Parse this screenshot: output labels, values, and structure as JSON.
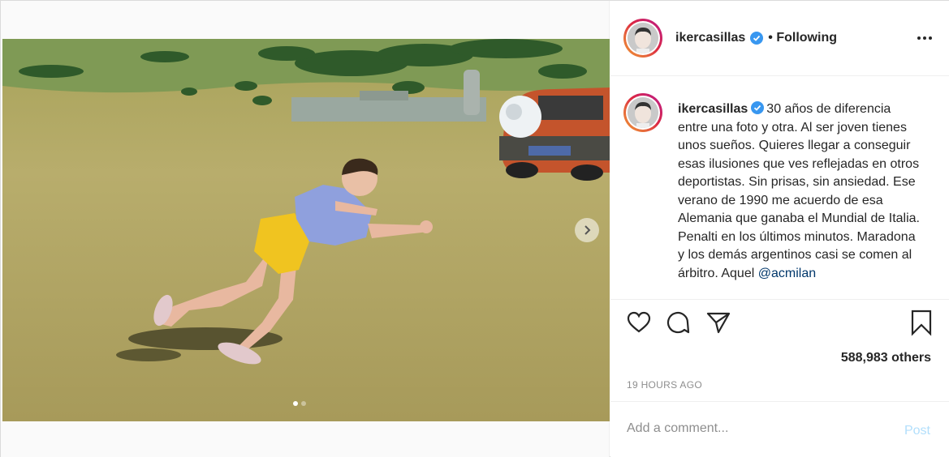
{
  "post": {
    "author": "ikercasillas",
    "follow_status": "• Following",
    "caption": {
      "author": "ikercasillas",
      "text": "30 años de diferencia entre una foto y otra. Al ser joven tienes unos sueños. Quieres llegar a conseguir esas ilusiones que ves reflejadas en otros deportistas. Sin prisas, sin ansiedad. Ese verano de 1990 me acuerdo de esa Alemania que ganaba el Mundial de Italia. Penalti en los últimos minutos. Maradona y los demás argentinos casi se comen al árbitro. Aquel",
      "mention": "@acmilan"
    },
    "likes": "588,983 others",
    "timestamp": "19 HOURS AGO",
    "comment": {
      "placeholder": "Add a comment...",
      "post_label": "Post"
    },
    "carousel": {
      "total": 2,
      "current": 1
    }
  },
  "icons": {
    "verified": "verified-badge-icon",
    "more": "more-options-icon",
    "like": "heart-icon",
    "comment": "comment-icon",
    "share": "share-icon",
    "save": "bookmark-icon",
    "next": "chevron-right-icon"
  },
  "colors": {
    "verified": "#3897f0",
    "mention": "#00376b",
    "post_button": "#b2dffc",
    "muted": "#8e8e8e"
  }
}
